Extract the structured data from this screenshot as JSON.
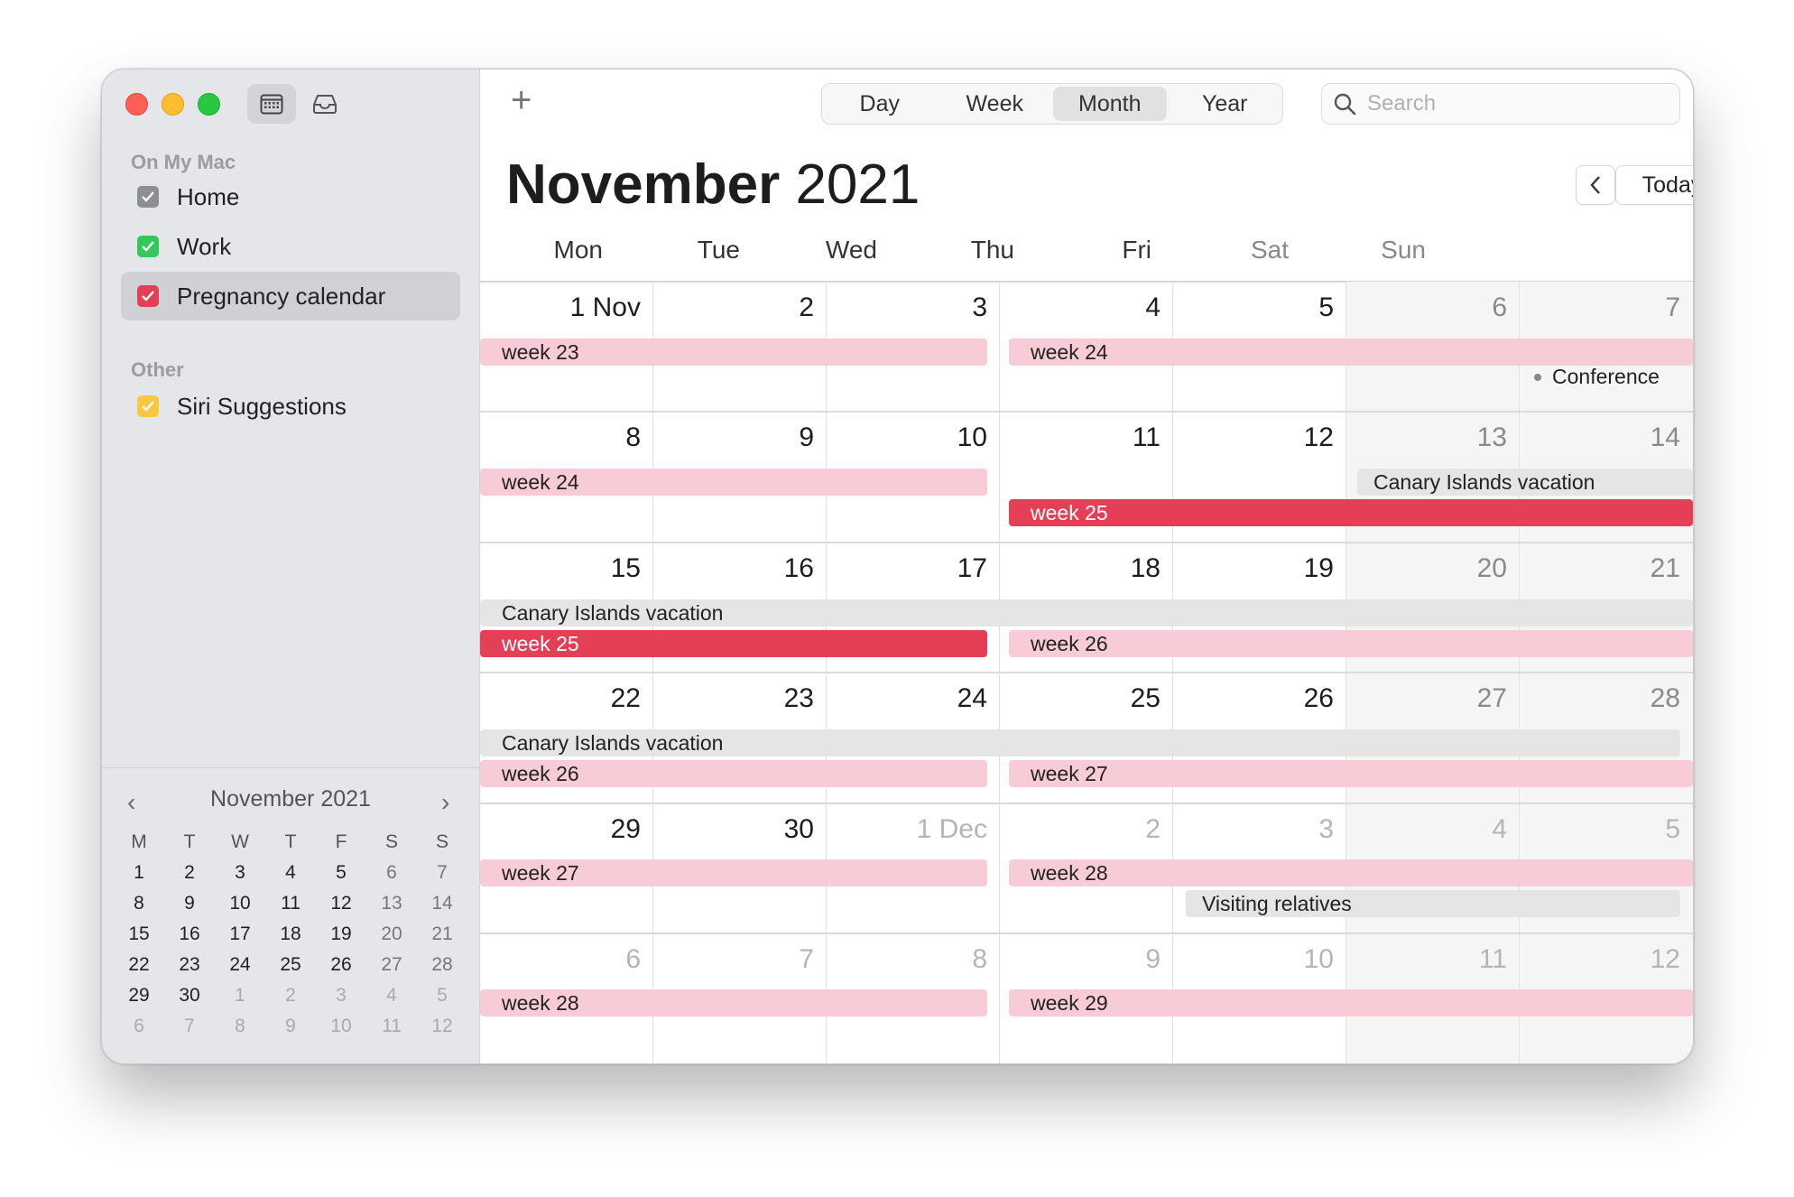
{
  "sidebar": {
    "on_my_mac_title": "On My Mac",
    "other_title": "Other",
    "calendars": [
      {
        "label": "Home",
        "color": "#8e8e93",
        "checked": true
      },
      {
        "label": "Work",
        "color": "#34c759",
        "checked": true
      },
      {
        "label": "Pregnancy calendar",
        "color": "#e53f58",
        "checked": true,
        "selected": true
      }
    ],
    "other_calendars": [
      {
        "label": "Siri Suggestions",
        "color": "#f7c73f",
        "checked": true
      }
    ]
  },
  "mini_calendar": {
    "title": "November 2021",
    "dow": [
      "M",
      "T",
      "W",
      "T",
      "F",
      "S",
      "S"
    ],
    "weeks": [
      [
        "1",
        "2",
        "3",
        "4",
        "5",
        "6",
        "7"
      ],
      [
        "8",
        "9",
        "10",
        "11",
        "12",
        "13",
        "14"
      ],
      [
        "15",
        "16",
        "17",
        "18",
        "19",
        "20",
        "21"
      ],
      [
        "22",
        "23",
        "24",
        "25",
        "26",
        "27",
        "28"
      ],
      [
        "29",
        "30",
        "1",
        "2",
        "3",
        "4",
        "5"
      ],
      [
        "6",
        "7",
        "8",
        "9",
        "10",
        "11",
        "12"
      ]
    ]
  },
  "toolbar": {
    "add_label": "+",
    "views": [
      "Day",
      "Week",
      "Month",
      "Year"
    ],
    "active_view": "Month",
    "search_placeholder": "Search"
  },
  "header": {
    "month": "November",
    "year": "2021",
    "today_label": "Today"
  },
  "weekdays": [
    "Mon",
    "Tue",
    "Wed",
    "Thu",
    "Fri",
    "Sat",
    "Sun"
  ],
  "weeks": [
    {
      "days": [
        "1 Nov",
        "2",
        "3",
        "4",
        "5",
        "6",
        "7"
      ],
      "out": [
        false,
        false,
        false,
        false,
        false,
        false,
        false
      ]
    },
    {
      "days": [
        "8",
        "9",
        "10",
        "11",
        "12",
        "13",
        "14"
      ],
      "out": [
        false,
        false,
        false,
        false,
        false,
        false,
        false
      ]
    },
    {
      "days": [
        "15",
        "16",
        "17",
        "18",
        "19",
        "20",
        "21"
      ],
      "out": [
        false,
        false,
        false,
        false,
        false,
        false,
        false
      ]
    },
    {
      "days": [
        "22",
        "23",
        "24",
        "25",
        "26",
        "27",
        "28"
      ],
      "out": [
        false,
        false,
        false,
        false,
        false,
        false,
        false
      ]
    },
    {
      "days": [
        "29",
        "30",
        "1 Dec",
        "2",
        "3",
        "4",
        "5"
      ],
      "out": [
        false,
        false,
        true,
        true,
        true,
        true,
        true
      ]
    },
    {
      "days": [
        "6",
        "7",
        "8",
        "9",
        "10",
        "11",
        "12"
      ],
      "out": [
        true,
        true,
        true,
        true,
        true,
        true,
        true
      ]
    }
  ],
  "events": {
    "w1_week23": "week 23",
    "w1_week24": "week 24",
    "w1_conference": "Conference",
    "w2_week24": "week 24",
    "w2_canary": "Canary Islands vacation",
    "w2_week25": "week 25",
    "w3_canary": "Canary Islands vacation",
    "w3_week25": "week 25",
    "w3_week26": "week 26",
    "w4_canary": "Canary Islands vacation",
    "w4_week26": "week 26",
    "w4_week27": "week 27",
    "w5_week27": "week 27",
    "w5_week28": "week 28",
    "w5_visiting": "Visiting relatives",
    "w6_week28": "week 28",
    "w6_week29": "week 29"
  }
}
